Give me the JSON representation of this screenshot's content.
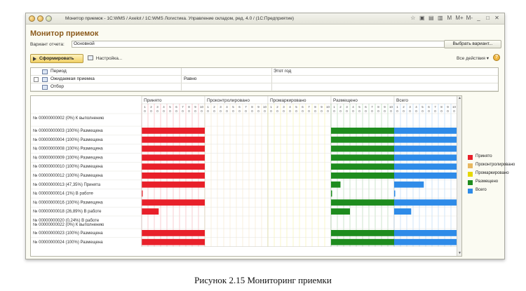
{
  "window": {
    "title": "Монитор приемок - 1С:WMS / Axelot / 1С:WMS Логистика. Управление складом, ред. 4.0 / (1С:Предприятие)",
    "icons": [
      "☆",
      "▣",
      "▤",
      "▥",
      "M",
      "M+",
      "M-",
      "_",
      "□",
      "✕"
    ]
  },
  "form": {
    "title": "Монитор приемок",
    "variant_label": "Вариант отчета:",
    "variant_value": "Основной",
    "variant_button": "Выбрать вариант...",
    "generate_button": "Сформировать",
    "settings_link": "Настройка...",
    "all_actions": "Все действия ▾",
    "help": "?"
  },
  "params": [
    {
      "name": "Период",
      "condition": "",
      "value": "Этот год",
      "checkbox": false
    },
    {
      "name": "Ожидаемая приемка",
      "condition": "Равно",
      "value": "",
      "checkbox": true
    },
    {
      "name": "Отбор",
      "condition": "",
      "value": "",
      "checkbox": false
    }
  ],
  "report": {
    "groups": [
      "Принято",
      "Проконтролировано",
      "Промаркировано",
      "Размещено",
      "Всего"
    ],
    "group_colors": [
      "#e8202a",
      "#e8b860",
      "#e6d800",
      "#1e8c1e",
      "#2e8be8"
    ],
    "day_numbers": [
      "1",
      "2",
      "3",
      "4",
      "5",
      "6",
      "7",
      "8",
      "9",
      "10"
    ],
    "rows": [
      {
        "label": "№ 00000000002 (0%) К выполнению",
        "fills": [
          0,
          0,
          0,
          0,
          0
        ],
        "tall": true
      },
      {
        "label": "№ 00000000003 (100%) Размещена",
        "fills": [
          1,
          0,
          0,
          1,
          1
        ]
      },
      {
        "label": "№ 00000000004 (100%) Размещена",
        "fills": [
          1,
          0,
          0,
          1,
          1
        ]
      },
      {
        "label": "№ 00000000008 (100%) Размещена",
        "fills": [
          1,
          0,
          0,
          1,
          1
        ]
      },
      {
        "label": "№ 00000000009 (100%) Размещена",
        "fills": [
          1,
          0,
          0,
          1,
          1
        ]
      },
      {
        "label": "№ 00000000010 (100%) Размещена",
        "fills": [
          1,
          0,
          0,
          1,
          1
        ]
      },
      {
        "label": "№ 00000000012 (100%) Размещена",
        "fills": [
          1,
          0,
          0,
          1,
          1
        ]
      },
      {
        "label": "№ 00000000013 (47,35%) Принята",
        "fills": [
          1,
          0,
          0,
          0.15,
          0.47
        ]
      },
      {
        "label": "№ 00000000014 (1%) В работе",
        "fills": [
          0.01,
          0,
          0,
          0.01,
          0.01
        ]
      },
      {
        "label": "№ 00000000016 (100%) Размещена",
        "fills": [
          1,
          0,
          0,
          1,
          1
        ]
      },
      {
        "label": "№ 00000000018 (26,89%) В работе",
        "fills": [
          0.27,
          0,
          0,
          0.3,
          0.27
        ]
      },
      {
        "label": "№ 00000000020 (0,24%) В работе / № 00000000022 (0%) К выполнению",
        "fills": [
          0,
          0,
          0,
          0,
          0
        ],
        "tall": true
      },
      {
        "label": "№ 00000000023 (100%) Размещена",
        "fills": [
          1,
          0,
          0,
          1,
          1
        ]
      },
      {
        "label": "№ 00000000024 (100%) Размещена",
        "fills": [
          1,
          0,
          0,
          1,
          1
        ]
      }
    ]
  },
  "legend": [
    {
      "label": "Принято",
      "color": "#e8202a"
    },
    {
      "label": "Проконтролировано",
      "color": "#e8b860"
    },
    {
      "label": "Промаркировано",
      "color": "#e6d800"
    },
    {
      "label": "Размещено",
      "color": "#1e8c1e"
    },
    {
      "label": "Всего",
      "color": "#2e8be8"
    }
  ],
  "caption": "Рисунок 2.15 Мониторинг приемки"
}
